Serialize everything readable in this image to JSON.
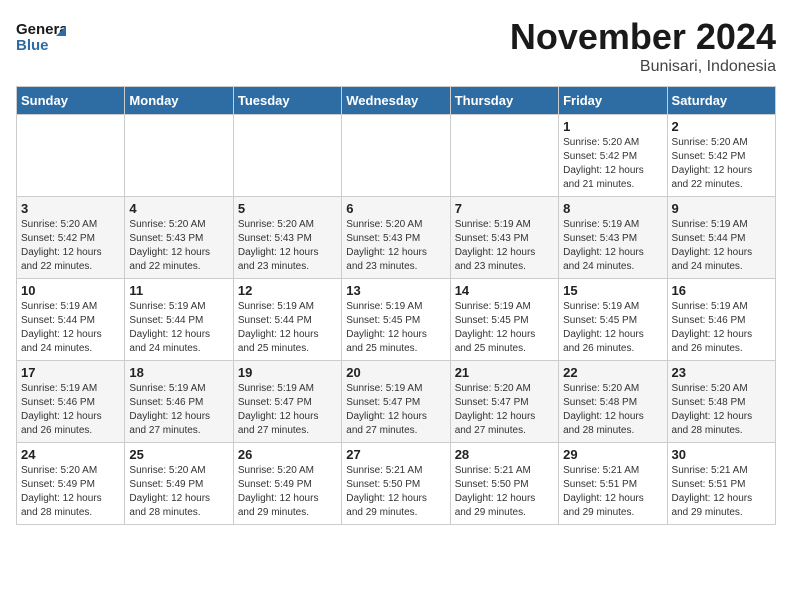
{
  "logo": {
    "line1": "General",
    "line2": "Blue"
  },
  "title": "November 2024",
  "subtitle": "Bunisari, Indonesia",
  "days_header": [
    "Sunday",
    "Monday",
    "Tuesday",
    "Wednesday",
    "Thursday",
    "Friday",
    "Saturday"
  ],
  "weeks": [
    [
      {
        "day": "",
        "info": ""
      },
      {
        "day": "",
        "info": ""
      },
      {
        "day": "",
        "info": ""
      },
      {
        "day": "",
        "info": ""
      },
      {
        "day": "",
        "info": ""
      },
      {
        "day": "1",
        "info": "Sunrise: 5:20 AM\nSunset: 5:42 PM\nDaylight: 12 hours\nand 21 minutes."
      },
      {
        "day": "2",
        "info": "Sunrise: 5:20 AM\nSunset: 5:42 PM\nDaylight: 12 hours\nand 22 minutes."
      }
    ],
    [
      {
        "day": "3",
        "info": "Sunrise: 5:20 AM\nSunset: 5:42 PM\nDaylight: 12 hours\nand 22 minutes."
      },
      {
        "day": "4",
        "info": "Sunrise: 5:20 AM\nSunset: 5:43 PM\nDaylight: 12 hours\nand 22 minutes."
      },
      {
        "day": "5",
        "info": "Sunrise: 5:20 AM\nSunset: 5:43 PM\nDaylight: 12 hours\nand 23 minutes."
      },
      {
        "day": "6",
        "info": "Sunrise: 5:20 AM\nSunset: 5:43 PM\nDaylight: 12 hours\nand 23 minutes."
      },
      {
        "day": "7",
        "info": "Sunrise: 5:19 AM\nSunset: 5:43 PM\nDaylight: 12 hours\nand 23 minutes."
      },
      {
        "day": "8",
        "info": "Sunrise: 5:19 AM\nSunset: 5:43 PM\nDaylight: 12 hours\nand 24 minutes."
      },
      {
        "day": "9",
        "info": "Sunrise: 5:19 AM\nSunset: 5:44 PM\nDaylight: 12 hours\nand 24 minutes."
      }
    ],
    [
      {
        "day": "10",
        "info": "Sunrise: 5:19 AM\nSunset: 5:44 PM\nDaylight: 12 hours\nand 24 minutes."
      },
      {
        "day": "11",
        "info": "Sunrise: 5:19 AM\nSunset: 5:44 PM\nDaylight: 12 hours\nand 24 minutes."
      },
      {
        "day": "12",
        "info": "Sunrise: 5:19 AM\nSunset: 5:44 PM\nDaylight: 12 hours\nand 25 minutes."
      },
      {
        "day": "13",
        "info": "Sunrise: 5:19 AM\nSunset: 5:45 PM\nDaylight: 12 hours\nand 25 minutes."
      },
      {
        "day": "14",
        "info": "Sunrise: 5:19 AM\nSunset: 5:45 PM\nDaylight: 12 hours\nand 25 minutes."
      },
      {
        "day": "15",
        "info": "Sunrise: 5:19 AM\nSunset: 5:45 PM\nDaylight: 12 hours\nand 26 minutes."
      },
      {
        "day": "16",
        "info": "Sunrise: 5:19 AM\nSunset: 5:46 PM\nDaylight: 12 hours\nand 26 minutes."
      }
    ],
    [
      {
        "day": "17",
        "info": "Sunrise: 5:19 AM\nSunset: 5:46 PM\nDaylight: 12 hours\nand 26 minutes."
      },
      {
        "day": "18",
        "info": "Sunrise: 5:19 AM\nSunset: 5:46 PM\nDaylight: 12 hours\nand 27 minutes."
      },
      {
        "day": "19",
        "info": "Sunrise: 5:19 AM\nSunset: 5:47 PM\nDaylight: 12 hours\nand 27 minutes."
      },
      {
        "day": "20",
        "info": "Sunrise: 5:19 AM\nSunset: 5:47 PM\nDaylight: 12 hours\nand 27 minutes."
      },
      {
        "day": "21",
        "info": "Sunrise: 5:20 AM\nSunset: 5:47 PM\nDaylight: 12 hours\nand 27 minutes."
      },
      {
        "day": "22",
        "info": "Sunrise: 5:20 AM\nSunset: 5:48 PM\nDaylight: 12 hours\nand 28 minutes."
      },
      {
        "day": "23",
        "info": "Sunrise: 5:20 AM\nSunset: 5:48 PM\nDaylight: 12 hours\nand 28 minutes."
      }
    ],
    [
      {
        "day": "24",
        "info": "Sunrise: 5:20 AM\nSunset: 5:49 PM\nDaylight: 12 hours\nand 28 minutes."
      },
      {
        "day": "25",
        "info": "Sunrise: 5:20 AM\nSunset: 5:49 PM\nDaylight: 12 hours\nand 28 minutes."
      },
      {
        "day": "26",
        "info": "Sunrise: 5:20 AM\nSunset: 5:49 PM\nDaylight: 12 hours\nand 29 minutes."
      },
      {
        "day": "27",
        "info": "Sunrise: 5:21 AM\nSunset: 5:50 PM\nDaylight: 12 hours\nand 29 minutes."
      },
      {
        "day": "28",
        "info": "Sunrise: 5:21 AM\nSunset: 5:50 PM\nDaylight: 12 hours\nand 29 minutes."
      },
      {
        "day": "29",
        "info": "Sunrise: 5:21 AM\nSunset: 5:51 PM\nDaylight: 12 hours\nand 29 minutes."
      },
      {
        "day": "30",
        "info": "Sunrise: 5:21 AM\nSunset: 5:51 PM\nDaylight: 12 hours\nand 29 minutes."
      }
    ]
  ]
}
